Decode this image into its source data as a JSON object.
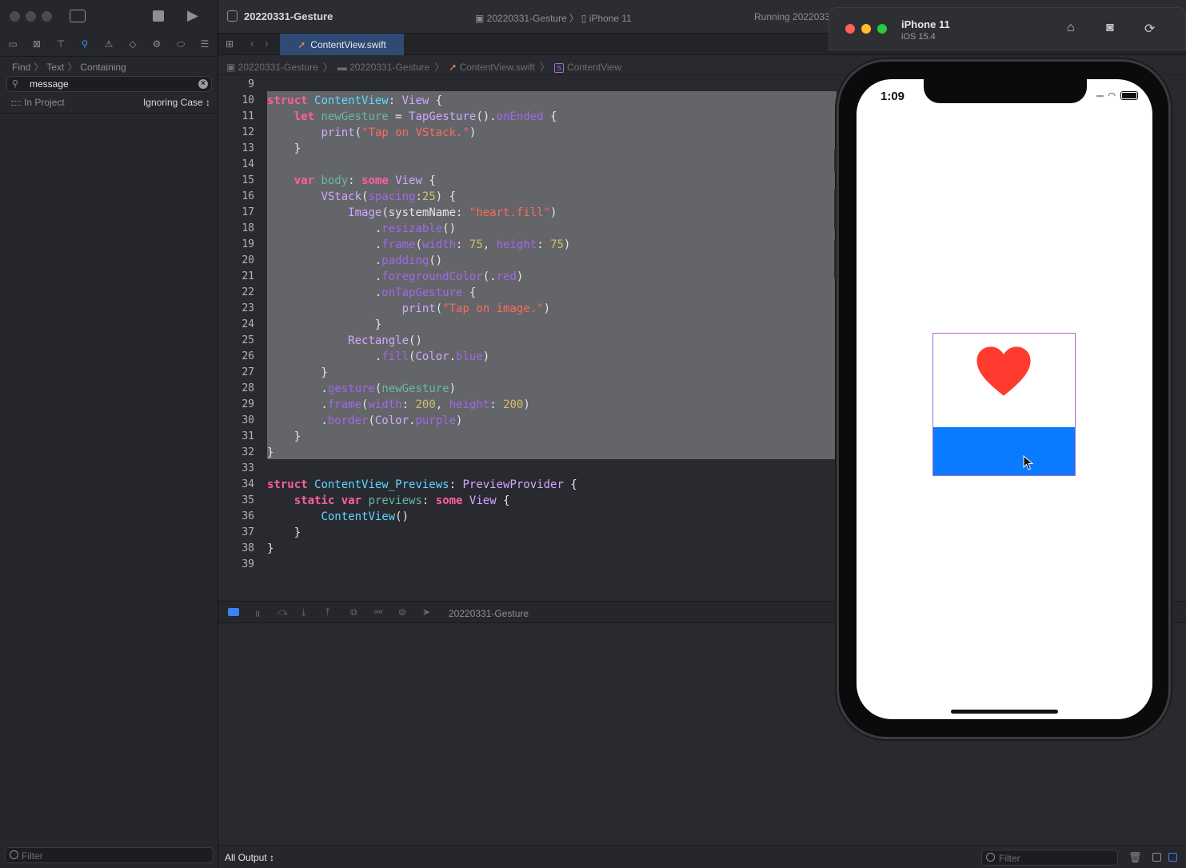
{
  "window": {
    "title": "20220331-Gesture",
    "scheme_project": "20220331-Gesture",
    "scheme_device": "iPhone 11",
    "status": "Running 2022033"
  },
  "navigator": {
    "find_breadcrumb": [
      "Find",
      "Text",
      "Containing"
    ],
    "search_value": "message",
    "scope": "In Project",
    "case_mode": "Ignoring Case ↕",
    "filter_placeholder": "Filter"
  },
  "editor": {
    "tab_label": "ContentView.swift",
    "jumpbar": [
      "20220331-Gesture",
      "20220331-Gesture",
      "ContentView.swift",
      "ContentView"
    ],
    "line_numbers": [
      "9",
      "10",
      "11",
      "12",
      "13",
      "14",
      "15",
      "16",
      "17",
      "18",
      "19",
      "20",
      "21",
      "22",
      "23",
      "24",
      "25",
      "26",
      "27",
      "28",
      "29",
      "30",
      "31",
      "32",
      "33",
      "34",
      "35",
      "36",
      "37",
      "38",
      "39"
    ],
    "code_lines": [
      "",
      "struct ContentView: View {",
      "    let newGesture = TapGesture().onEnded {",
      "        print(\"Tap on VStack.\")",
      "    }",
      "",
      "    var body: some View {",
      "        VStack(spacing:25) {",
      "            Image(systemName: \"heart.fill\")",
      "                .resizable()",
      "                .frame(width: 75, height: 75)",
      "                .padding()",
      "                .foregroundColor(.red)",
      "                .onTapGesture {",
      "                    print(\"Tap on image.\")",
      "                }",
      "            Rectangle()",
      "                .fill(Color.blue)",
      "        }",
      "        .gesture(newGesture)",
      "        .frame(width: 200, height: 200)",
      "        .border(Color.purple)",
      "    }",
      "}",
      "",
      "struct ContentView_Previews: PreviewProvider {",
      "    static var previews: some View {",
      "        ContentView()",
      "    }",
      "}",
      ""
    ]
  },
  "debug": {
    "target": "20220331-Gesture",
    "output_mode": "All Output ↕",
    "filter_placeholder": "Filter"
  },
  "simulator": {
    "device_name": "iPhone 11",
    "os_version": "iOS 15.4",
    "time": "1:09",
    "heart_color": "#ff3b30",
    "rect_color": "#0a7aff",
    "border_color": "#a569d3"
  }
}
